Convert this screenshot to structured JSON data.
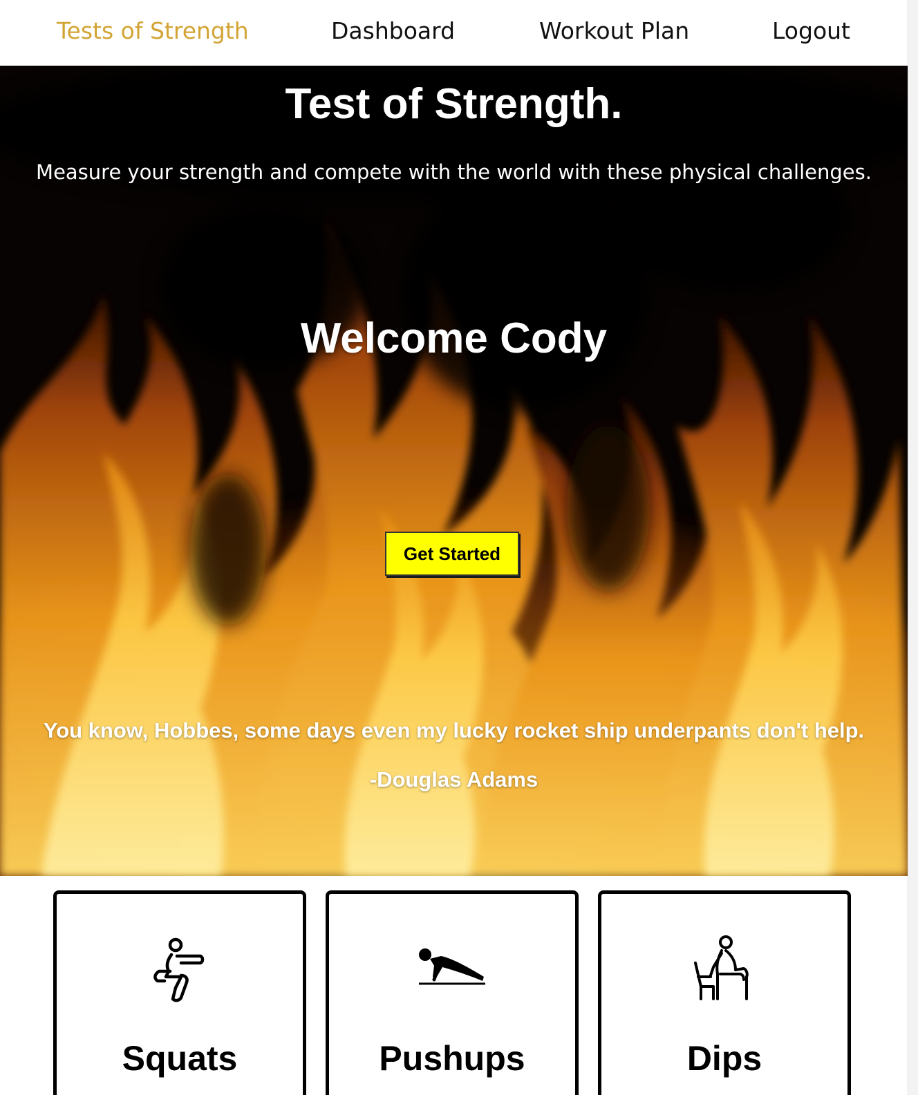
{
  "nav": {
    "brand": "Tests of Strength",
    "links": [
      "Dashboard",
      "Workout Plan",
      "Logout"
    ],
    "brand_color": "#d3a434"
  },
  "hero": {
    "title": "Test of Strength.",
    "subtitle": "Measure your strength and compete with the world with these physical challenges.",
    "welcome": "Welcome Cody",
    "cta_label": "Get Started",
    "cta_color": "#ffff00",
    "quote": "You know, Hobbes, some days even my lucky rocket ship underpants don't help.",
    "quote_author": "-Douglas Adams",
    "background": "fire-flames-image"
  },
  "exercises": [
    {
      "label": "Squats",
      "icon": "squat-icon"
    },
    {
      "label": "Pushups",
      "icon": "pushup-icon"
    },
    {
      "label": "Dips",
      "icon": "dips-icon"
    }
  ]
}
